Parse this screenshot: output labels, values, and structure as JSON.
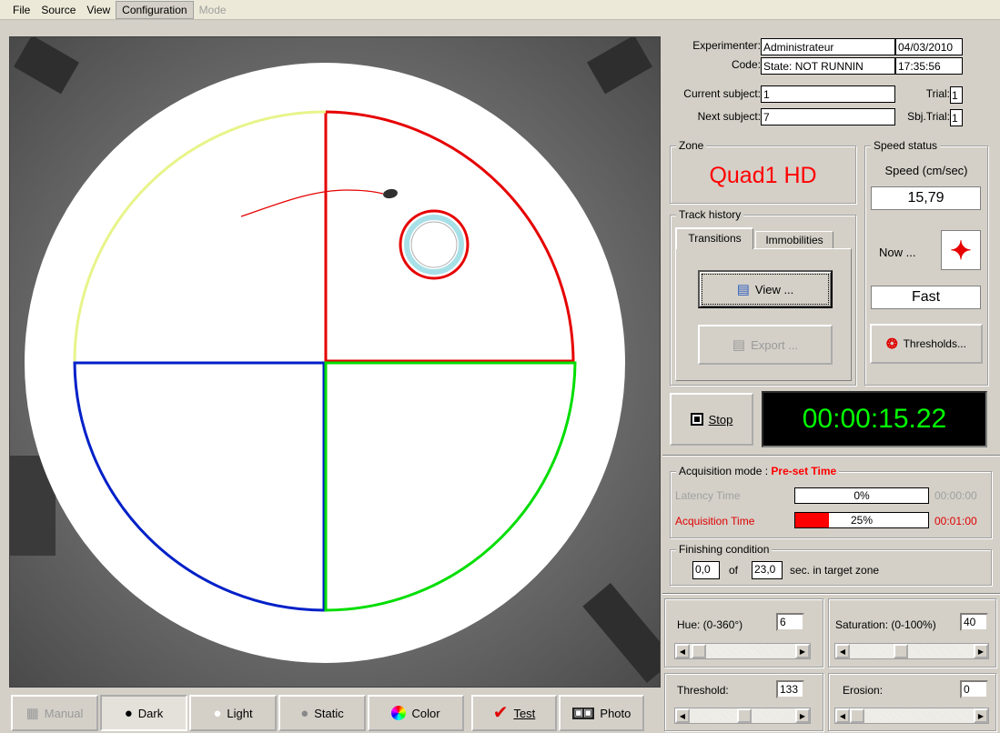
{
  "menu": {
    "items": [
      "File",
      "Source",
      "View",
      "Configuration",
      "Mode"
    ]
  },
  "info": {
    "experimenter_label": "Experimenter:",
    "experimenter_value": "Administrateur",
    "date": "04/03/2010",
    "code_label": "Code:",
    "code_value": "State: NOT RUNNIN",
    "time": "17:35:56",
    "current_subject_label": "Current subject:",
    "current_subject_value": "1",
    "trial_label": "Trial:",
    "trial_value": "1",
    "next_subject_label": "Next subject:",
    "next_subject_value": "7",
    "sbj_trial_label": "Sbj.Trial:",
    "sbj_trial_value": "1"
  },
  "zone": {
    "title": "Zone",
    "value": "Quad1 HD",
    "color": "#ff0000"
  },
  "track_history": {
    "title": "Track history",
    "tabs": [
      "Transitions",
      "Immobilities"
    ],
    "view_label": "View ...",
    "export_label": "Export ..."
  },
  "speed": {
    "title": "Speed status",
    "label": "Speed (cm/sec)",
    "value": "15,79",
    "now_label": "Now ...",
    "status": "Fast",
    "thresholds_label": "Thresholds..."
  },
  "stop": {
    "label": "Stop",
    "timer": "00:00:15.22",
    "timer_color": "#00ff00"
  },
  "acquisition": {
    "title": "Acquisition mode :",
    "mode": "Pre-set Time",
    "latency_label": "Latency Time",
    "latency_percent": "0%",
    "latency_fraction": 0,
    "latency_time": "00:00:00",
    "acq_label": "Acquisition Time",
    "acq_percent": "25%",
    "acq_fraction": 0.25,
    "acq_time": "00:01:00"
  },
  "finishing": {
    "title": "Finishing condition",
    "value1": "0,0",
    "of": "of",
    "value2": "23,0",
    "suffix": "sec. in target zone"
  },
  "controls": {
    "hue_label": "Hue:  (0-360°)",
    "hue_value": "6",
    "hue_fraction": 0.02,
    "saturation_label": "Saturation: (0-100%)",
    "saturation_value": "40",
    "saturation_fraction": 0.4,
    "threshold_label": "Threshold:",
    "threshold_value": "133",
    "threshold_fraction": 0.52,
    "erosion_label": "Erosion:",
    "erosion_value": "0",
    "erosion_fraction": 0
  },
  "toolbar": {
    "manual": "Manual",
    "dark": "Dark",
    "light": "Light",
    "static": "Static",
    "color": "Color",
    "test": "Test",
    "photo": "Photo"
  },
  "quadrants": {
    "q1_color": "#e60000",
    "q2_color": "#e8f48a",
    "q3_color": "#0020c8",
    "q4_color": "#00dd00"
  }
}
